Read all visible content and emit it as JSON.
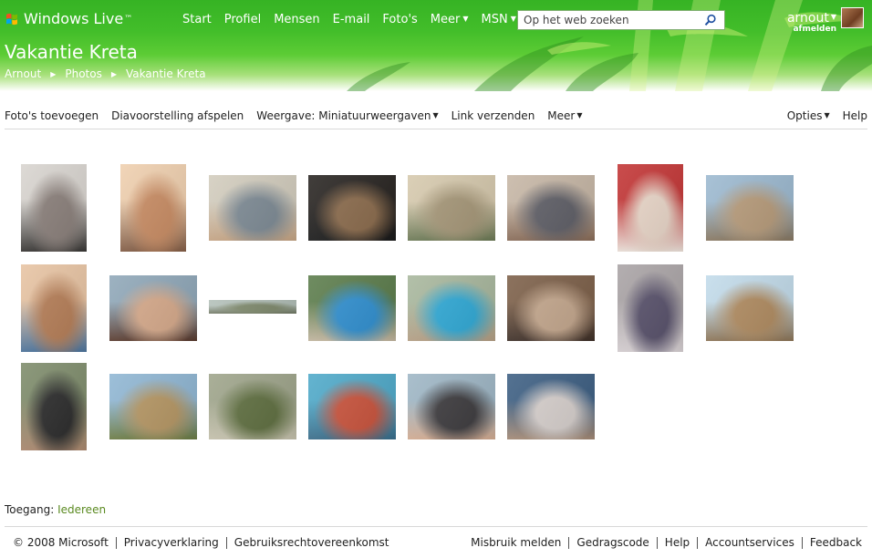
{
  "header": {
    "brand": "Windows Live",
    "brand_mark": "™",
    "nav": [
      {
        "label": "Start",
        "menu": false
      },
      {
        "label": "Profiel",
        "menu": false
      },
      {
        "label": "Mensen",
        "menu": false
      },
      {
        "label": "E-mail",
        "menu": false
      },
      {
        "label": "Foto's",
        "menu": false
      },
      {
        "label": "Meer",
        "menu": true
      },
      {
        "label": "MSN",
        "menu": true
      }
    ],
    "search_placeholder": "Op het web zoeken",
    "user_name": "arnout",
    "sign_out": "afmelden"
  },
  "album": {
    "title": "Vakantie Kreta",
    "breadcrumb": [
      "Arnout",
      "Photos",
      "Vakantie Kreta"
    ]
  },
  "toolbar": {
    "add_photos": "Foto's toevoegen",
    "slideshow": "Diavoorstelling afspelen",
    "view": "Weergave: Miniatuurweergaven",
    "send_link": "Link verzenden",
    "more": "Meer",
    "options": "Opties",
    "help": "Help"
  },
  "photos": [
    {
      "name": "baby-portrait",
      "colors": [
        "#d8d4cf",
        "#8a7f7a",
        "#3a3836"
      ]
    },
    {
      "name": "toddler-face",
      "colors": [
        "#efcfae",
        "#c98c63",
        "#876048"
      ]
    },
    {
      "name": "kids-on-sunbed",
      "colors": [
        "#d2ccbd",
        "#7d8a94",
        "#c8a685"
      ]
    },
    {
      "name": "dinner-night",
      "colors": [
        "#272320",
        "#8a6a4b",
        "#1a1a1a"
      ]
    },
    {
      "name": "villa-courtyard",
      "colors": [
        "#d6c9ad",
        "#a69778",
        "#6c7a55"
      ]
    },
    {
      "name": "family-terrace",
      "colors": [
        "#c6b6a5",
        "#5e5e66",
        "#8a6c58"
      ]
    },
    {
      "name": "baby-red-chair",
      "colors": [
        "#c23434",
        "#e9d6c8",
        "#f2e7df"
      ]
    },
    {
      "name": "stroller-road",
      "colors": [
        "#9cb9d0",
        "#b79b7a",
        "#8a7962"
      ]
    },
    {
      "name": "toddler-smile",
      "colors": [
        "#e7c3a2",
        "#b57d56",
        "#4f77a0"
      ]
    },
    {
      "name": "mother-and-child",
      "colors": [
        "#8fa7b8",
        "#d6a98a",
        "#5a3a2d"
      ]
    },
    {
      "name": "panorama-hills",
      "colors": [
        "#b3c0b9",
        "#7f8a6d",
        "#6d7560"
      ]
    },
    {
      "name": "pool-garden",
      "colors": [
        "#5b7c4b",
        "#2f8fd0",
        "#c6b9a2"
      ]
    },
    {
      "name": "pool-swimmer",
      "colors": [
        "#a8b79d",
        "#2fa9d6",
        "#b7a186"
      ]
    },
    {
      "name": "family-cave",
      "colors": [
        "#7c5f48",
        "#c3a68c",
        "#3f3028"
      ]
    },
    {
      "name": "baby-in-carrier",
      "colors": [
        "#a9a3a5",
        "#57506a",
        "#dcd5d8"
      ]
    },
    {
      "name": "stone-house",
      "colors": [
        "#c2dbea",
        "#b08b60",
        "#8e7556"
      ]
    },
    {
      "name": "mother-standing",
      "colors": [
        "#7d8b6a",
        "#2a2a2a",
        "#b08c72"
      ]
    },
    {
      "name": "garden-hut",
      "colors": [
        "#8fb6d3",
        "#b59663",
        "#6d7d44"
      ]
    },
    {
      "name": "trees-path",
      "colors": [
        "#9ea48a",
        "#5e6e3f",
        "#c9c5b0"
      ]
    },
    {
      "name": "pool-float",
      "colors": [
        "#4ea9c9",
        "#c9523b",
        "#3a6e8c"
      ]
    },
    {
      "name": "family-seaside",
      "colors": [
        "#9eb6c5",
        "#3c3a3d",
        "#d7ae93"
      ]
    },
    {
      "name": "family-group",
      "colors": [
        "#3c5e82",
        "#d6cfcc",
        "#a88d78"
      ]
    }
  ],
  "access": {
    "label": "Toegang:",
    "value": "Iedereen"
  },
  "footer": {
    "left": [
      "© 2008 Microsoft",
      "Privacyverklaring",
      "Gebruiksrechtovereenkomst"
    ],
    "right": [
      "Misbruik melden",
      "Gedragscode",
      "Help",
      "Accountservices",
      "Feedback"
    ]
  }
}
